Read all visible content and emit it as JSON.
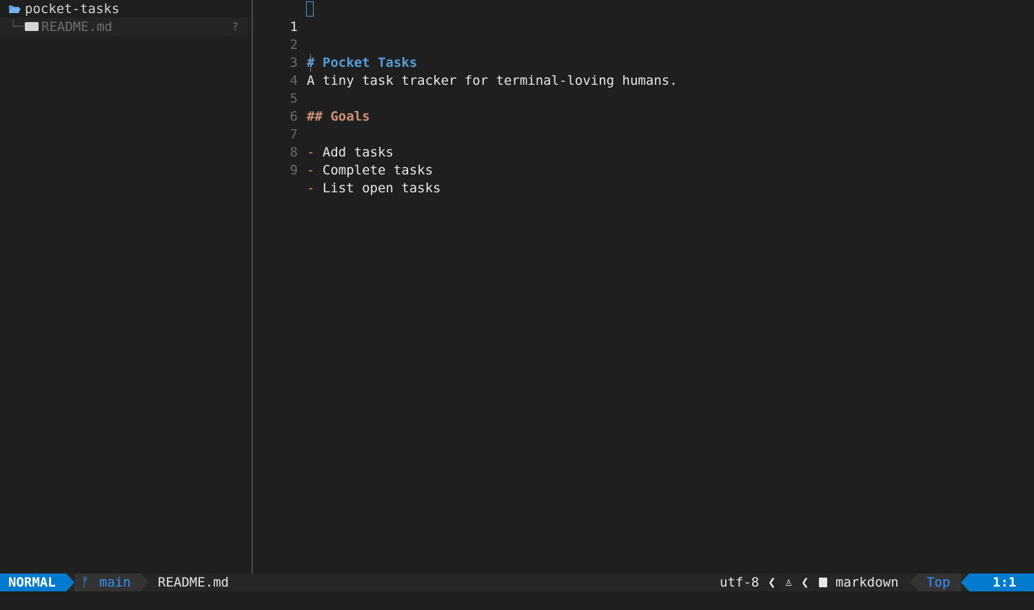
{
  "sidebar": {
    "root_folder": "pocket-tasks",
    "tree_branch": "└─",
    "files": [
      {
        "name": "README.md",
        "icon": "markdown-icon",
        "git_status": "?"
      }
    ]
  },
  "editor": {
    "lines": [
      {
        "num": "1",
        "marker": "#",
        "text": " Pocket Tasks",
        "kind": "h1"
      },
      {
        "num": "2",
        "text": "",
        "kind": "blank"
      },
      {
        "num": "3",
        "text": "A tiny task tracker for terminal-loving humans.",
        "kind": "text"
      },
      {
        "num": "4",
        "text": "",
        "kind": "blank"
      },
      {
        "num": "5",
        "text": "## Goals",
        "kind": "h2"
      },
      {
        "num": "6",
        "text": "",
        "kind": "blank"
      },
      {
        "num": "7",
        "marker": "-",
        "text": " Add tasks",
        "kind": "bullet"
      },
      {
        "num": "8",
        "marker": "-",
        "text": " Complete tasks",
        "kind": "bullet"
      },
      {
        "num": "9",
        "marker": "-",
        "text": " List open tasks",
        "kind": "bullet"
      }
    ]
  },
  "statusline": {
    "mode": "NORMAL",
    "branch_icon": "ᚠ",
    "branch": "main",
    "filename": "README.md",
    "encoding": "utf-8",
    "separator": "❮",
    "os_icon": "♙",
    "filetype": "markdown",
    "scroll": "Top",
    "position": "1:1"
  },
  "colors": {
    "accent": "#007acc",
    "heading1": "#569cd6",
    "heading2": "#ce9178",
    "background": "#1f1f1f"
  }
}
